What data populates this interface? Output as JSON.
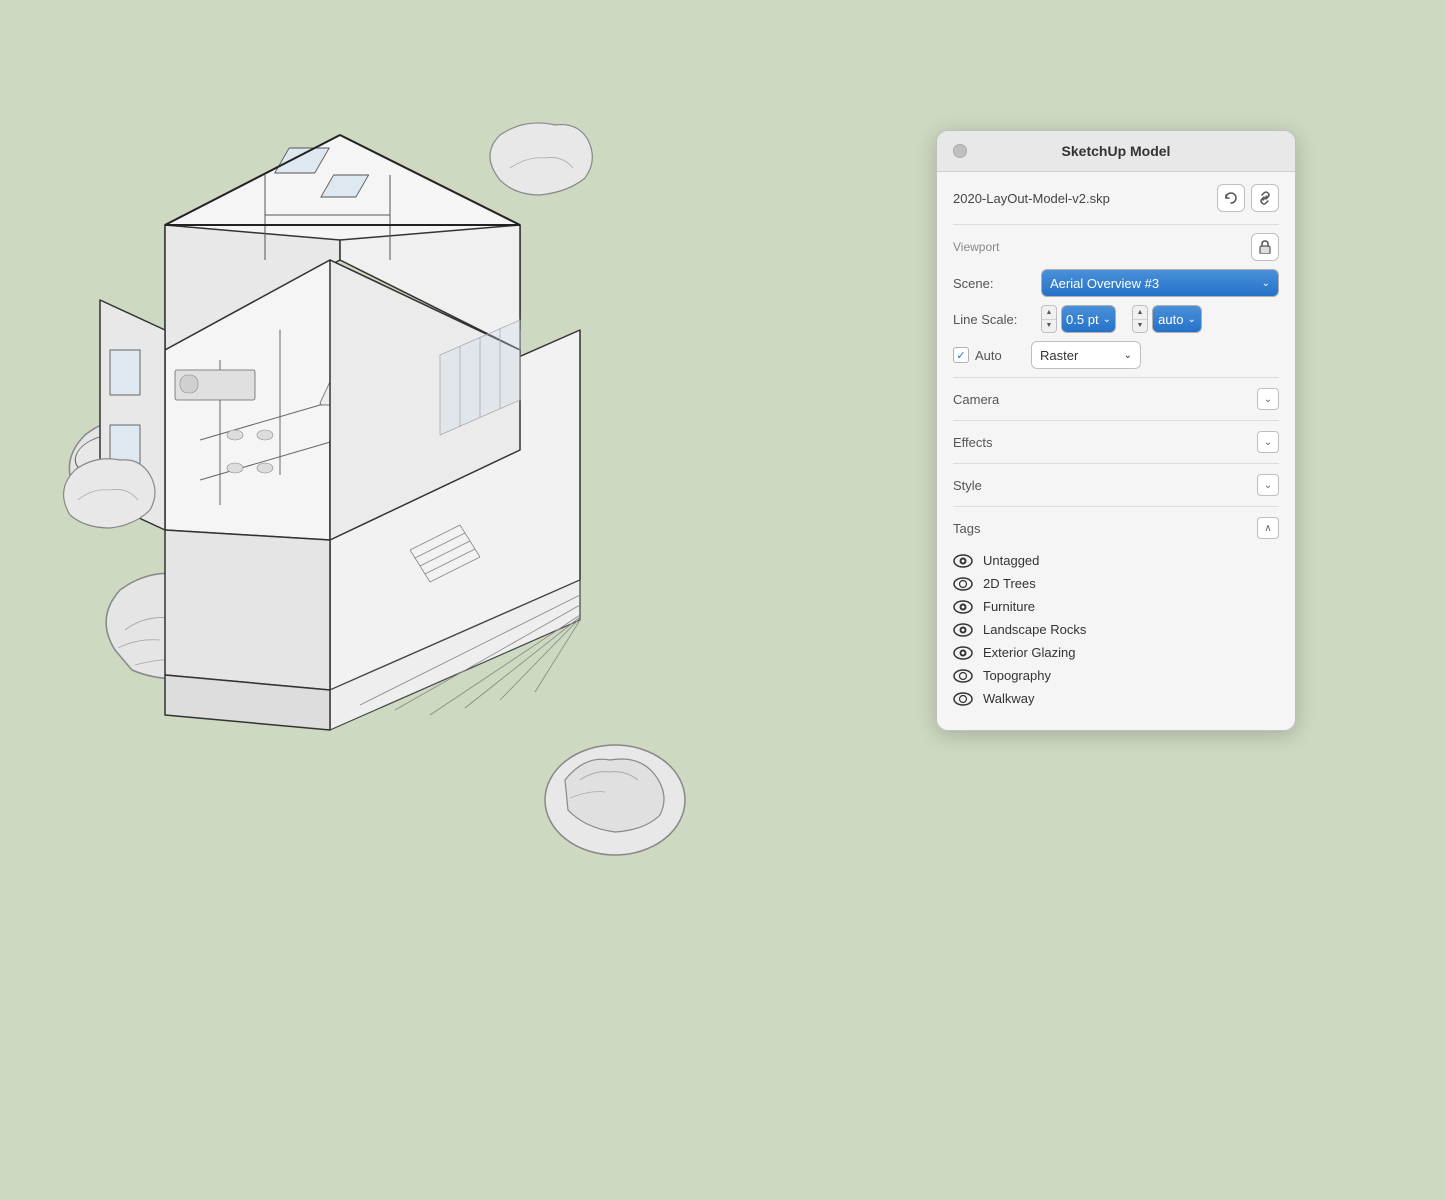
{
  "app": {
    "background_color": "#cdd9c0"
  },
  "panel": {
    "title": "SketchUp Model",
    "traffic_light_color": "#c0c0c0",
    "file_name": "2020-LayOut-Model-v2.skp",
    "refresh_icon": "↻",
    "link_icon": "⛓",
    "viewport_label": "Viewport",
    "scene_label": "Scene:",
    "scene_value": "Aerial Overview #3",
    "line_scale_label": "Line Scale:",
    "line_scale_value": "0.5 pt",
    "line_scale_auto": "auto",
    "auto_label": "Auto",
    "render_mode": "Raster",
    "sections": {
      "camera": {
        "label": "Camera",
        "expanded": false
      },
      "effects": {
        "label": "Effects",
        "expanded": false
      },
      "style": {
        "label": "Style",
        "expanded": false
      },
      "tags": {
        "label": "Tags",
        "expanded": true
      }
    },
    "tags": [
      {
        "name": "Untagged",
        "visible": true,
        "eye_filled": true
      },
      {
        "name": "2D Trees",
        "visible": true,
        "eye_filled": false
      },
      {
        "name": "Furniture",
        "visible": true,
        "eye_filled": true
      },
      {
        "name": "Landscape Rocks",
        "visible": true,
        "eye_filled": true
      },
      {
        "name": "Exterior Glazing",
        "visible": true,
        "eye_filled": true
      },
      {
        "name": "Topography",
        "visible": true,
        "eye_filled": false
      },
      {
        "name": "Walkway",
        "visible": true,
        "eye_filled": false
      }
    ]
  }
}
